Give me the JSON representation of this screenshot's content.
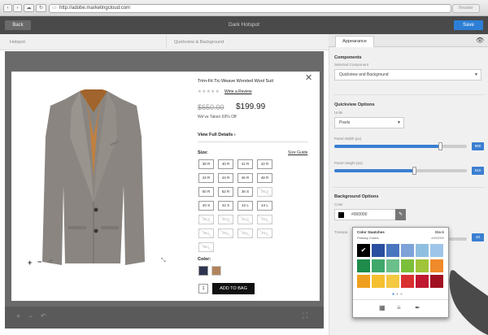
{
  "browser": {
    "url": "http://adobe.marketingcloud.com",
    "reader_label": "Reader",
    "nav_icons": [
      "back-arrow-icon",
      "forward-arrow-icon",
      "cloud-icon",
      "reload-icon"
    ]
  },
  "header": {
    "back_label": "Back",
    "title": "Dark Hotspot",
    "save_label": "Save"
  },
  "left_tabs": {
    "hotspot": "Hotspot",
    "quickview": "Quickview & Background"
  },
  "product": {
    "name": "Trim-Fit Tic-Weave Worsted Wool Suit",
    "write_review": "Write a Review",
    "stars_filled": 0,
    "old_price": "$650.00",
    "new_price": "$199.99",
    "discount": "We've Taken 69% Off",
    "view_details": "View Full Details",
    "size_label": "Size:",
    "size_guide": "Size Guide",
    "sizes": [
      {
        "label": "38 R",
        "available": true
      },
      {
        "label": "40 R",
        "available": true
      },
      {
        "label": "41 R",
        "available": true
      },
      {
        "label": "42 R",
        "available": true
      },
      {
        "label": "43 R",
        "available": true
      },
      {
        "label": "44 R",
        "available": true
      },
      {
        "label": "46 R",
        "available": true
      },
      {
        "label": "48 R",
        "available": true
      },
      {
        "label": "50 R",
        "available": true
      },
      {
        "label": "52 R",
        "available": true
      },
      {
        "label": "36 S",
        "available": true
      },
      {
        "label": "38 S",
        "available": false
      },
      {
        "label": "40 S",
        "available": true
      },
      {
        "label": "42 S",
        "available": true
      },
      {
        "label": "42 L",
        "available": true
      },
      {
        "label": "44 L",
        "available": true
      },
      {
        "label": "36 S",
        "available": false
      },
      {
        "label": "40 S",
        "available": false
      },
      {
        "label": "42 S",
        "available": false
      },
      {
        "label": "44 L",
        "available": false
      },
      {
        "label": "36 L",
        "available": false
      },
      {
        "label": "40 L",
        "available": false
      },
      {
        "label": "42 L",
        "available": false
      },
      {
        "label": "44 L",
        "available": false
      },
      {
        "label": "50 L",
        "available": false
      }
    ],
    "color_label": "Color:",
    "colors": [
      "#2e3450",
      "#b0845c"
    ],
    "quantity": "1",
    "add_to_bag": "ADD TO BAG",
    "image_controls": [
      "zoom-in-icon",
      "zoom-out-icon",
      "reset-icon"
    ]
  },
  "right_panel": {
    "tab_label": "Appearance",
    "components_header": "Components",
    "selected_component_label": "Selected Component",
    "selected_component_value": "Quickview and Background",
    "quickview_options_header": "Quickview Options",
    "units_label": "Units",
    "units_value": "Pixels",
    "panel_width_label": "Panel Width (px)",
    "panel_width_value": "980",
    "panel_width_fraction": 0.8,
    "panel_height_label": "Panel Height (px)",
    "panel_height_value": "610",
    "panel_height_fraction": 0.6,
    "background_options_header": "Background Options",
    "color_label": "Color",
    "color_value": "#000000",
    "color_swatch": "#000000",
    "transparency_label": "Transpa",
    "transparency_value": "40"
  },
  "color_popup": {
    "title": "Color Swatches",
    "subtitle": "Primary Colors",
    "selected_name": "Black",
    "selected_hex": "#000000",
    "swatches": [
      "#000000",
      "#2a4fa0",
      "#4a76c0",
      "#7da3d8",
      "#8fbfe0",
      "#9fc5e8",
      "#1e8c4a",
      "#3fa86a",
      "#6abf8a",
      "#7cbf3a",
      "#a0c43a",
      "#f08a2a",
      "#f0a020",
      "#f5c030",
      "#f5c842",
      "#d93030",
      "#c01830",
      "#a01020"
    ],
    "footer_icons": [
      "swatch-grid-icon",
      "sliders-icon",
      "eyedropper-icon"
    ]
  }
}
